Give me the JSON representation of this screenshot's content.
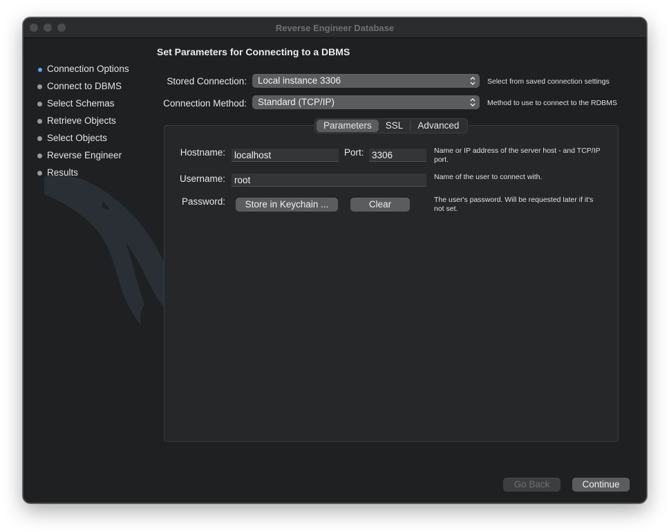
{
  "window": {
    "title": "Reverse Engineer Database"
  },
  "sidebar": {
    "steps": [
      {
        "label": "Connection Options",
        "active": true
      },
      {
        "label": "Connect to DBMS",
        "active": false
      },
      {
        "label": "Select Schemas",
        "active": false
      },
      {
        "label": "Retrieve Objects",
        "active": false
      },
      {
        "label": "Select Objects",
        "active": false
      },
      {
        "label": "Reverse Engineer",
        "active": false
      },
      {
        "label": "Results",
        "active": false
      }
    ]
  },
  "main": {
    "heading": "Set Parameters for Connecting to a DBMS",
    "stored_connection": {
      "label": "Stored Connection:",
      "value": "Local instance 3306",
      "hint": "Select from saved connection settings"
    },
    "connection_method": {
      "label": "Connection Method:",
      "value": "Standard (TCP/IP)",
      "hint": "Method to use to connect to the RDBMS"
    },
    "tabs": [
      {
        "label": "Parameters",
        "active": true
      },
      {
        "label": "SSL",
        "active": false
      },
      {
        "label": "Advanced",
        "active": false
      }
    ],
    "parameters": {
      "hostname_label": "Hostname:",
      "hostname_value": "localhost",
      "port_label": "Port:",
      "port_value": "3306",
      "hostname_hint_line1": "Name or IP address of the server host - and TCP/IP",
      "hostname_hint_line2": "port.",
      "username_label": "Username:",
      "username_value": "root",
      "username_hint": "Name of the user to connect with.",
      "password_label": "Password:",
      "store_keychain_label": "Store in Keychain ...",
      "clear_label": "Clear",
      "password_hint_line1": "The user's password. Will be requested later if it's",
      "password_hint_line2": "not set."
    }
  },
  "footer": {
    "go_back_label": "Go Back",
    "continue_label": "Continue"
  },
  "colors": {
    "window_bg": "#1f2021",
    "control_bg": "#5b5c5d",
    "active_step": "#5aa2ff"
  },
  "icons": [
    "close-traffic-light",
    "minimize-traffic-light",
    "zoom-traffic-light",
    "dolphin-logo-watermark",
    "popup-arrows-icon"
  ]
}
